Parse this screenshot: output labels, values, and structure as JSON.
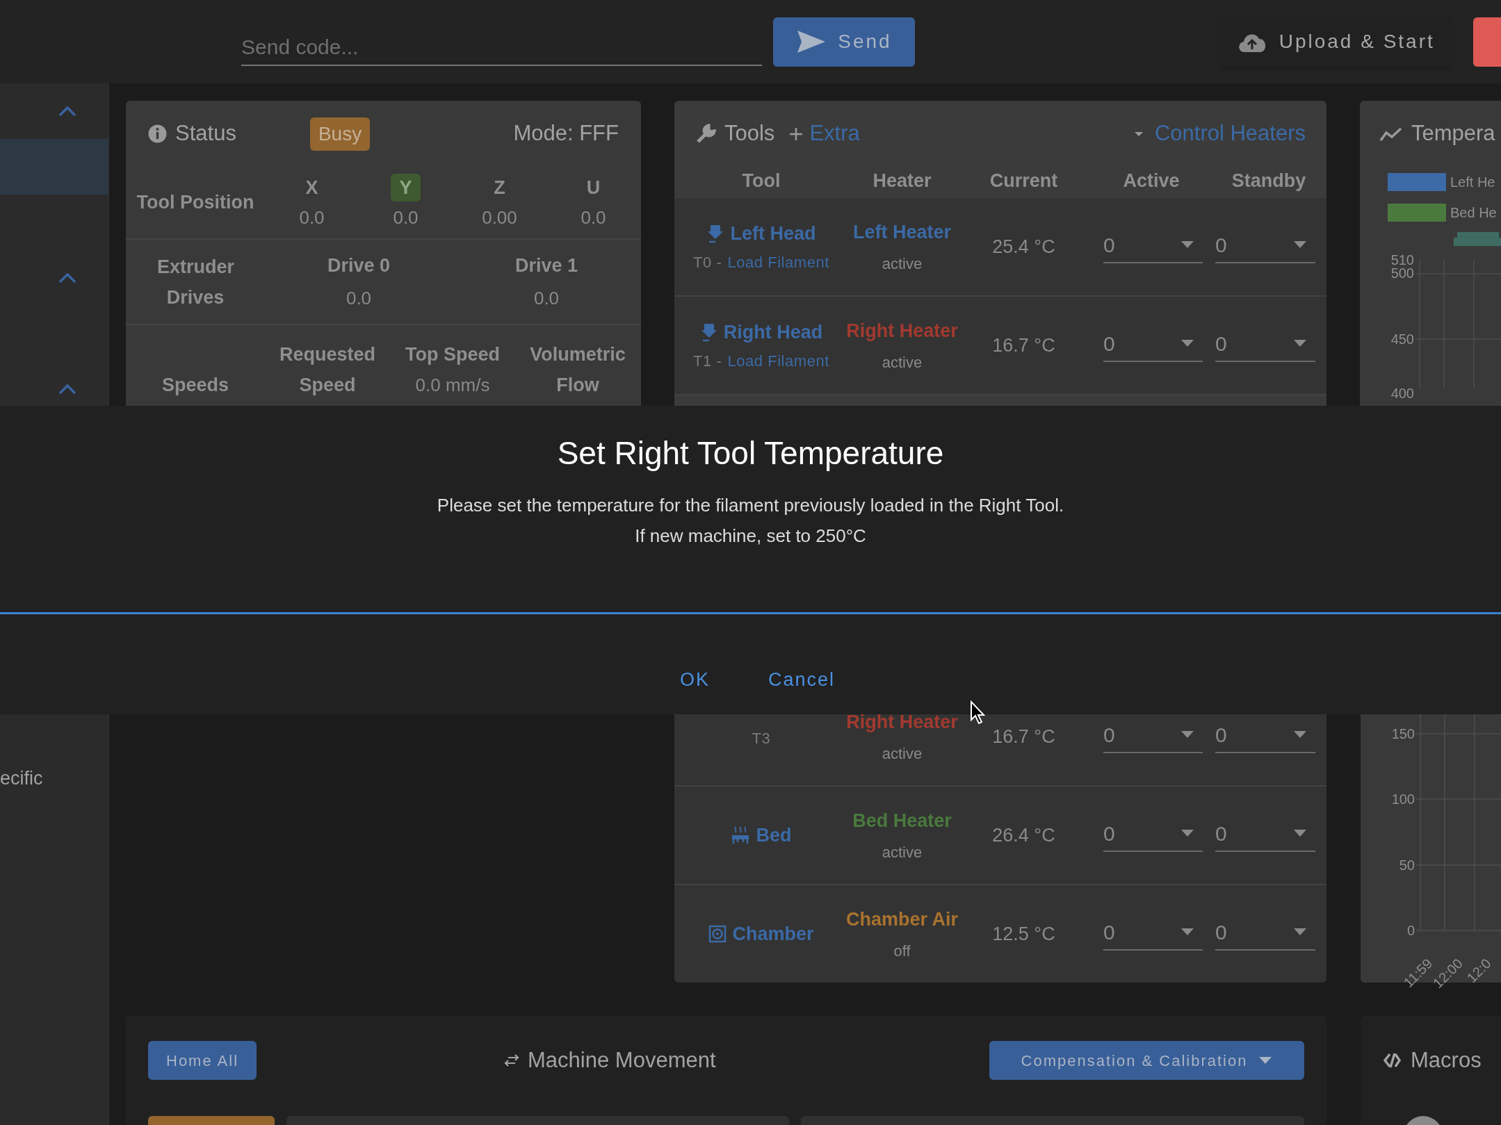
{
  "top_bar": {
    "code_field": {
      "placeholder": "Send code..."
    },
    "send_button": "Send",
    "upload_button": "Upload & Start"
  },
  "sidebar": {
    "groups": [
      {
        "expanded": true,
        "items": [
          {
            "selected": true
          }
        ]
      },
      {
        "expanded": true
      },
      {
        "expanded": true
      }
    ],
    "label_fragment": "ecific"
  },
  "status": {
    "title": "Status",
    "badge": "Busy",
    "mode": "Mode: FFF",
    "tool_position": {
      "label": "Tool Position",
      "axes": [
        {
          "name": "X",
          "value": "0.0",
          "homed": false
        },
        {
          "name": "Y",
          "value": "0.0",
          "homed": true
        },
        {
          "name": "Z",
          "value": "0.00",
          "homed": false
        },
        {
          "name": "U",
          "value": "0.0",
          "homed": false
        }
      ]
    },
    "extruder": {
      "label": "Extruder Drives",
      "drives": [
        {
          "name": "Drive 0",
          "value": "0.0"
        },
        {
          "name": "Drive 1",
          "value": "0.0"
        }
      ]
    },
    "speeds": {
      "label": "Speeds",
      "columns": [
        {
          "name": "Requested Speed"
        },
        {
          "name": "Top Speed",
          "value": "0.0 mm/s"
        },
        {
          "name": "Volumetric Flow"
        }
      ]
    }
  },
  "tools": {
    "title": "Tools",
    "extra": "Extra",
    "control": "Control Heaters",
    "columns": [
      "Tool",
      "Heater",
      "Current",
      "Active",
      "Standby"
    ],
    "rows": [
      {
        "kind": "tool",
        "name": "Left Head",
        "number": "T0 -",
        "link": "Load Filament",
        "heater": "Left Heater",
        "color": "#3b6aa6",
        "heater_state": "active",
        "current": "25.4 °C",
        "active": "0",
        "standby": "0"
      },
      {
        "kind": "tool",
        "name": "Right Head",
        "number": "T1 -",
        "link": "Load Filament",
        "heater": "Right Heater",
        "color": "#a23a2f",
        "heater_state": "active",
        "current": "16.7 °C",
        "active": "0",
        "standby": "0"
      }
    ]
  },
  "temperature": {
    "title": "Tempera",
    "legend": [
      {
        "label": "Left He",
        "color": "#3b6aa6"
      },
      {
        "label": "Bed He",
        "color": "#4a7a3e"
      }
    ],
    "y_ticks_upper": [
      "510",
      "500",
      "450",
      "400"
    ]
  },
  "dialog": {
    "title": "Set Right Tool Temperature",
    "lines": [
      "Please set the temperature for the filament previously loaded in the Right Tool.",
      "If new machine, set to 250°C"
    ],
    "buttons": [
      "OK",
      "Cancel"
    ]
  },
  "tools_continued": {
    "rows": [
      {
        "kind": "tool",
        "number": "T3",
        "heater": "Right Heater",
        "color": "#a23a2f",
        "heater_state": "active",
        "current": "16.7 °C",
        "active": "0",
        "standby": "0"
      },
      {
        "kind": "bed",
        "name": "Bed",
        "heater": "Bed Heater",
        "color": "#4a7a3e",
        "heater_state": "active",
        "current": "26.4 °C",
        "active": "0",
        "standby": "0"
      },
      {
        "kind": "chamber",
        "name": "Chamber",
        "heater": "Chamber Air",
        "color": "#a8722f",
        "heater_state": "off",
        "current": "12.5 °C",
        "active": "0",
        "standby": "0"
      }
    ]
  },
  "temperature_continued": {
    "y_ticks": [
      "150",
      "100",
      "50",
      "0"
    ],
    "x_ticks": [
      "11:59",
      "12:00",
      "12:0"
    ]
  },
  "machine_movement": {
    "home_button": "Home All",
    "title": "Machine Movement",
    "dropdown": "Compensation & Calibration"
  },
  "macros": {
    "title": "Macros"
  }
}
